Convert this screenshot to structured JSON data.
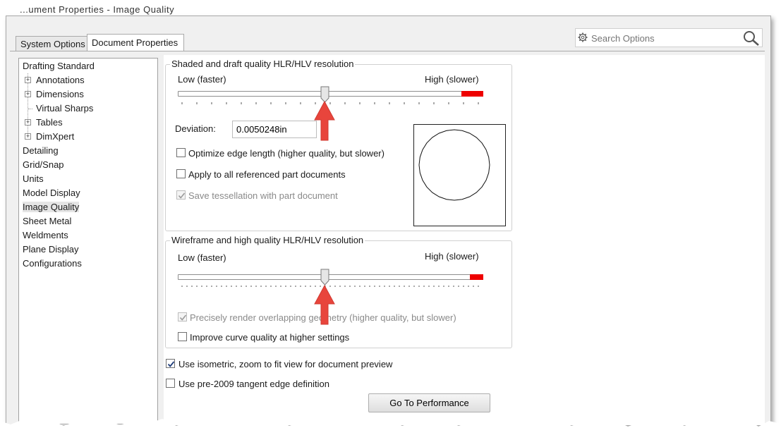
{
  "window": {
    "title_fragment": "...ument Properties - Image Quality"
  },
  "tabs": [
    {
      "label": "System Options",
      "active": false
    },
    {
      "label": "Document Properties",
      "active": true
    }
  ],
  "search": {
    "placeholder": "Search Options"
  },
  "tree": {
    "items": [
      {
        "label": "Drafting Standard",
        "level": 0,
        "expandable": false
      },
      {
        "label": "Annotations",
        "level": 1,
        "expandable": true
      },
      {
        "label": "Dimensions",
        "level": 1,
        "expandable": true
      },
      {
        "label": "Virtual Sharps",
        "level": 1,
        "expandable": false
      },
      {
        "label": "Tables",
        "level": 1,
        "expandable": true
      },
      {
        "label": "DimXpert",
        "level": 1,
        "expandable": true
      },
      {
        "label": "Detailing",
        "level": 0,
        "expandable": false
      },
      {
        "label": "Grid/Snap",
        "level": 0,
        "expandable": false
      },
      {
        "label": "Units",
        "level": 0,
        "expandable": false
      },
      {
        "label": "Model Display",
        "level": 0,
        "expandable": false
      },
      {
        "label": "Image Quality",
        "level": 0,
        "expandable": false,
        "selected": true
      },
      {
        "label": "Sheet Metal",
        "level": 0,
        "expandable": false
      },
      {
        "label": "Weldments",
        "level": 0,
        "expandable": false
      },
      {
        "label": "Plane Display",
        "level": 0,
        "expandable": false
      },
      {
        "label": "Configurations",
        "level": 0,
        "expandable": false
      }
    ]
  },
  "shaded": {
    "title": "Shaded and draft quality HLR/HLV resolution",
    "low_label": "Low (faster)",
    "high_label": "High (slower)",
    "slider_value": 0.48,
    "deviation_label": "Deviation:",
    "deviation_value": "0.0050248in",
    "optimize_label": "Optimize edge length (higher quality, but slower)",
    "optimize_checked": false,
    "apply_label": "Apply to all referenced part documents",
    "apply_checked": false,
    "save_label": "Save tessellation with part document",
    "save_checked": true,
    "save_disabled": true
  },
  "wireframe": {
    "title": "Wireframe and high quality HLR/HLV resolution",
    "low_label": "Low (faster)",
    "high_label": "High (slower)",
    "slider_value": 0.48,
    "precise_label": "Precisely render overlapping geometry (higher quality, but slower)",
    "precise_checked": true,
    "precise_disabled": true,
    "curve_label": "Improve curve quality at higher settings",
    "curve_checked": false
  },
  "options": {
    "isometric_label": "Use isometric, zoom to fit view for document preview",
    "isometric_checked": true,
    "pre2009_label": "Use pre-2009 tangent edge definition",
    "pre2009_checked": false
  },
  "buttons": {
    "performance_label": "Go To Performance"
  },
  "colors": {
    "accent_red": "#ee0000",
    "annotation_arrow": "#e8453c"
  }
}
